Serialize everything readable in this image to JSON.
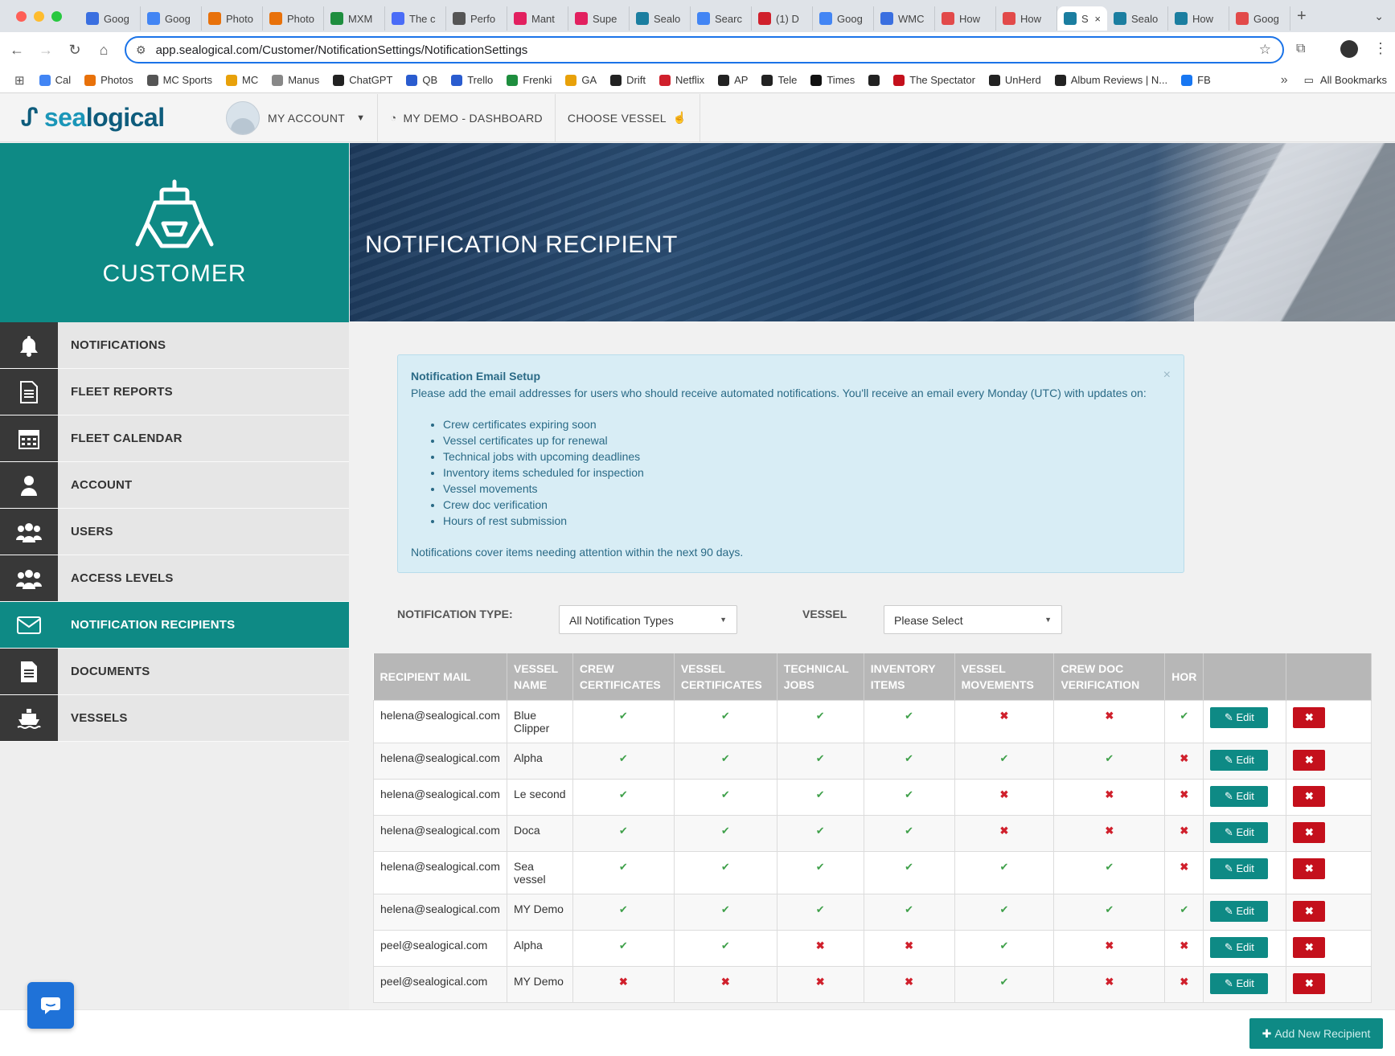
{
  "browser": {
    "tabs": [
      {
        "label": "Goog",
        "color": "#3a6fe0"
      },
      {
        "label": "Goog",
        "color": "#4285f4"
      },
      {
        "label": "Photo",
        "color": "#e8710a"
      },
      {
        "label": "Photo",
        "color": "#e8710a"
      },
      {
        "label": "MXM",
        "color": "#1e8e3e"
      },
      {
        "label": "The c",
        "color": "#4a6cf7"
      },
      {
        "label": "Perfo",
        "color": "#555555"
      },
      {
        "label": "Mant",
        "color": "#e2205f"
      },
      {
        "label": "Supe",
        "color": "#e2205f"
      },
      {
        "label": "Sealo",
        "color": "#1b7ea0"
      },
      {
        "label": "Searc",
        "color": "#4285f4"
      },
      {
        "label": "(1) D",
        "color": "#d0202c"
      },
      {
        "label": "Goog",
        "color": "#4285f4"
      },
      {
        "label": "WMC",
        "color": "#3a6fe0"
      },
      {
        "label": "How",
        "color": "#e24a4a"
      },
      {
        "label": "How",
        "color": "#e24a4a"
      },
      {
        "label": "S",
        "color": "#1b7ea0"
      },
      {
        "label": "Sealo",
        "color": "#1b7ea0"
      },
      {
        "label": "How",
        "color": "#1b7ea0"
      },
      {
        "label": "Goog",
        "color": "#e24a4a"
      }
    ],
    "active_tab_index": 16,
    "url": "app.sealogical.com/Customer/NotificationSettings/NotificationSettings",
    "bookmarks": [
      {
        "label": "Cal",
        "color": "#4285f4"
      },
      {
        "label": "Photos",
        "color": "#e8710a"
      },
      {
        "label": "MC Sports",
        "color": "#555555"
      },
      {
        "label": "MC",
        "color": "#e8a10a"
      },
      {
        "label": "Manus",
        "color": "#888888"
      },
      {
        "label": "ChatGPT",
        "color": "#222222"
      },
      {
        "label": "QB",
        "color": "#2a5ccf"
      },
      {
        "label": "Trello",
        "color": "#2a5ccf"
      },
      {
        "label": "Frenki",
        "color": "#1e8e3e"
      },
      {
        "label": "GA",
        "color": "#e8a10a"
      },
      {
        "label": "Drift",
        "color": "#222222"
      },
      {
        "label": "Netflix",
        "color": "#d0202c"
      },
      {
        "label": "AP",
        "color": "#222222"
      },
      {
        "label": "Tele",
        "color": "#222222"
      },
      {
        "label": "Times",
        "color": "#111111"
      },
      {
        "label": "",
        "color": "#222222"
      },
      {
        "label": "The Spectator",
        "color": "#c4101c"
      },
      {
        "label": "UnHerd",
        "color": "#222222"
      },
      {
        "label": "Album Reviews | N...",
        "color": "#222222"
      },
      {
        "label": "FB",
        "color": "#1877f2"
      }
    ],
    "all_bookmarks": "All Bookmarks"
  },
  "header": {
    "logo_sea": "sea",
    "logo_logical": "logical",
    "nav": [
      {
        "label": "MY ACCOUNT"
      },
      {
        "label": "MY DEMO - DASHBOARD"
      },
      {
        "label": "CHOOSE VESSEL"
      }
    ]
  },
  "sidebar": {
    "title": "CUSTOMER",
    "items": [
      {
        "label": "NOTIFICATIONS",
        "icon": "bell-icon"
      },
      {
        "label": "FLEET REPORTS",
        "icon": "document-icon"
      },
      {
        "label": "FLEET CALENDAR",
        "icon": "calendar-icon"
      },
      {
        "label": "ACCOUNT",
        "icon": "user-icon"
      },
      {
        "label": "USERS",
        "icon": "users-icon"
      },
      {
        "label": "ACCESS LEVELS",
        "icon": "users-icon"
      },
      {
        "label": "NOTIFICATION RECIPIENTS",
        "icon": "envelope-icon",
        "active": true
      },
      {
        "label": "DOCUMENTS",
        "icon": "file-icon"
      },
      {
        "label": "VESSELS",
        "icon": "ship-icon"
      }
    ]
  },
  "banner": {
    "title": "NOTIFICATION RECIPIENT"
  },
  "alert": {
    "title": "Notification Email Setup",
    "intro": "Please add the email addresses for users who should receive automated notifications. You'll receive an email every Monday (UTC) with updates on:",
    "items": [
      "Crew certificates expiring soon",
      "Vessel certificates up for renewal",
      "Technical jobs with upcoming deadlines",
      "Inventory items scheduled for inspection",
      "Vessel movements",
      "Crew doc verification",
      "Hours of rest submission"
    ],
    "footer": "Notifications cover items needing attention within the next 90 days.",
    "close": "×"
  },
  "filters": {
    "type_label": "NOTIFICATION TYPE:",
    "type_value": "All Notification Types",
    "vessel_label": "VESSEL",
    "vessel_value": "Please Select"
  },
  "table": {
    "headers": [
      "RECIPIENT MAIL",
      "VESSEL NAME",
      "CREW CERTIFICATES",
      "VESSEL CERTIFICATES",
      "TECHNICAL JOBS",
      "INVENTORY ITEMS",
      "VESSEL MOVEMENTS",
      "CREW DOC VERIFICATION",
      "HOR",
      "",
      ""
    ],
    "edit_label": "Edit",
    "rows": [
      {
        "mail": "helena@sealogical.com",
        "vessel": "Blue Clipper",
        "flags": [
          true,
          true,
          true,
          true,
          false,
          false,
          true
        ]
      },
      {
        "mail": "helena@sealogical.com",
        "vessel": "Alpha",
        "flags": [
          true,
          true,
          true,
          true,
          true,
          true,
          false
        ]
      },
      {
        "mail": "helena@sealogical.com",
        "vessel": "Le second",
        "flags": [
          true,
          true,
          true,
          true,
          false,
          false,
          false
        ]
      },
      {
        "mail": "helena@sealogical.com",
        "vessel": "Doca",
        "flags": [
          true,
          true,
          true,
          true,
          false,
          false,
          false
        ]
      },
      {
        "mail": "helena@sealogical.com",
        "vessel": "Sea vessel",
        "flags": [
          true,
          true,
          true,
          true,
          true,
          true,
          false
        ]
      },
      {
        "mail": "helena@sealogical.com",
        "vessel": "MY Demo",
        "flags": [
          true,
          true,
          true,
          true,
          true,
          true,
          true
        ]
      },
      {
        "mail": "peel@sealogical.com",
        "vessel": "Alpha",
        "flags": [
          true,
          true,
          false,
          false,
          true,
          false,
          false
        ]
      },
      {
        "mail": "peel@sealogical.com",
        "vessel": "MY Demo",
        "flags": [
          false,
          false,
          false,
          false,
          true,
          false,
          false
        ]
      }
    ]
  },
  "footer": {
    "add_button": "Add New Recipient"
  },
  "colors": {
    "teal": "#0e8a85",
    "danger": "#c4101c",
    "success": "#3fa04a",
    "header_gray": "#b7b7b7"
  }
}
